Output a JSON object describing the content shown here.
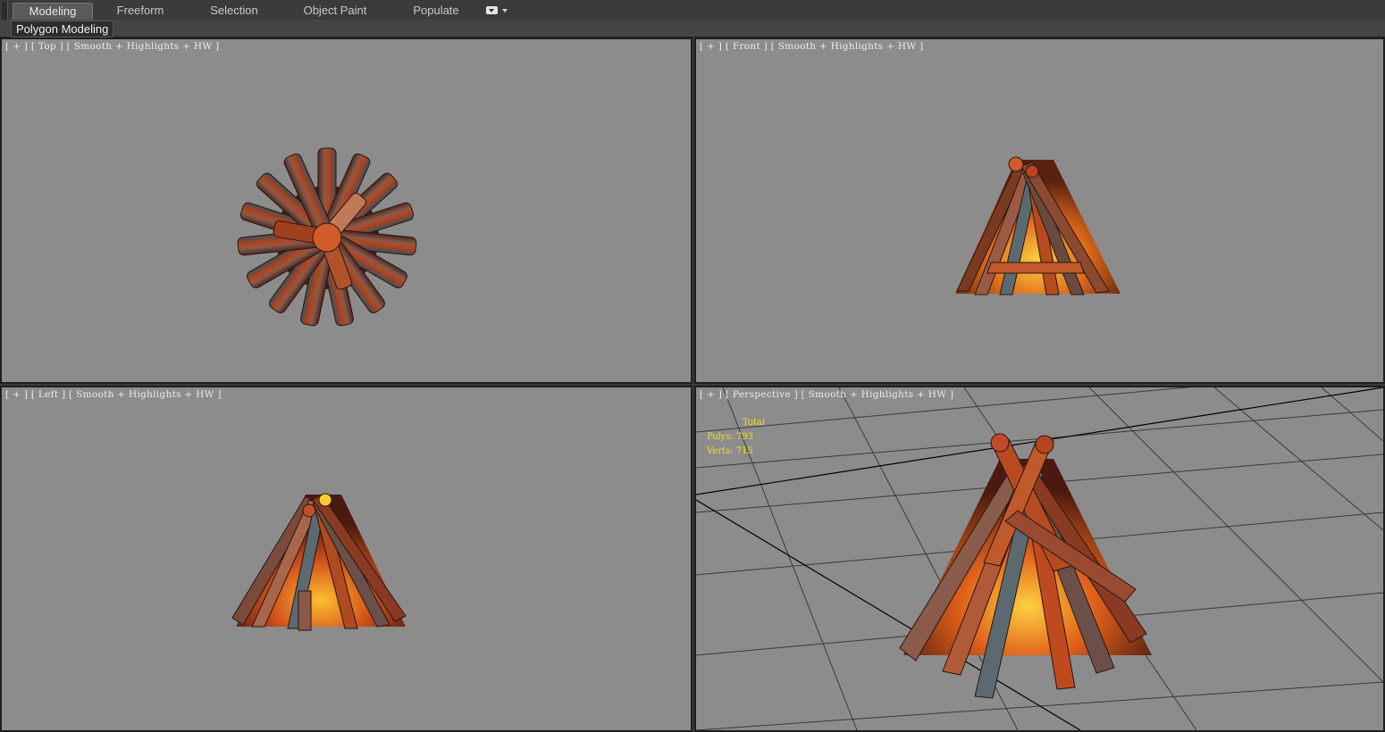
{
  "ribbon": {
    "tabs": [
      {
        "label": "Modeling",
        "active": true
      },
      {
        "label": "Freeform",
        "active": false
      },
      {
        "label": "Selection",
        "active": false
      },
      {
        "label": "Object Paint",
        "active": false
      },
      {
        "label": "Populate",
        "active": false
      }
    ],
    "dropdown_icon": "ribbon-options-icon"
  },
  "subbar": {
    "panel_label": "Polygon Modeling"
  },
  "viewports": {
    "top": {
      "open": "[ ",
      "plus": "+",
      "sep1": " ] [ ",
      "view": "Top",
      "sep2": " ] [ ",
      "shading": "Smooth + Highlights + HW",
      "close": " ]"
    },
    "front": {
      "open": "[ ",
      "plus": "+",
      "sep1": " ] [ ",
      "view": "Front",
      "sep2": " ] [ ",
      "shading": "Smooth + Highlights + HW",
      "close": " ]"
    },
    "left": {
      "open": "[ ",
      "plus": "+",
      "sep1": " ] [ ",
      "view": "Left",
      "sep2": " ] [ ",
      "shading": "Smooth + Highlights + HW",
      "close": " ]"
    },
    "perspective": {
      "open": "[ ",
      "plus": "+",
      "sep1": " ] [ ",
      "view": "Perspective",
      "sep2": " ] [ ",
      "shading": "Smooth + Highlights + HW",
      "close": " ]"
    }
  },
  "stats": {
    "heading": "Total",
    "polys_label": "Polys:",
    "polys_value": "793",
    "verts_label": "Verts:",
    "verts_value": "715"
  },
  "colors": {
    "viewport_bg": "#8c8c8c",
    "stats_text": "#f2e11a",
    "fire_core": "#ffb020",
    "ember": "#c8401a"
  }
}
